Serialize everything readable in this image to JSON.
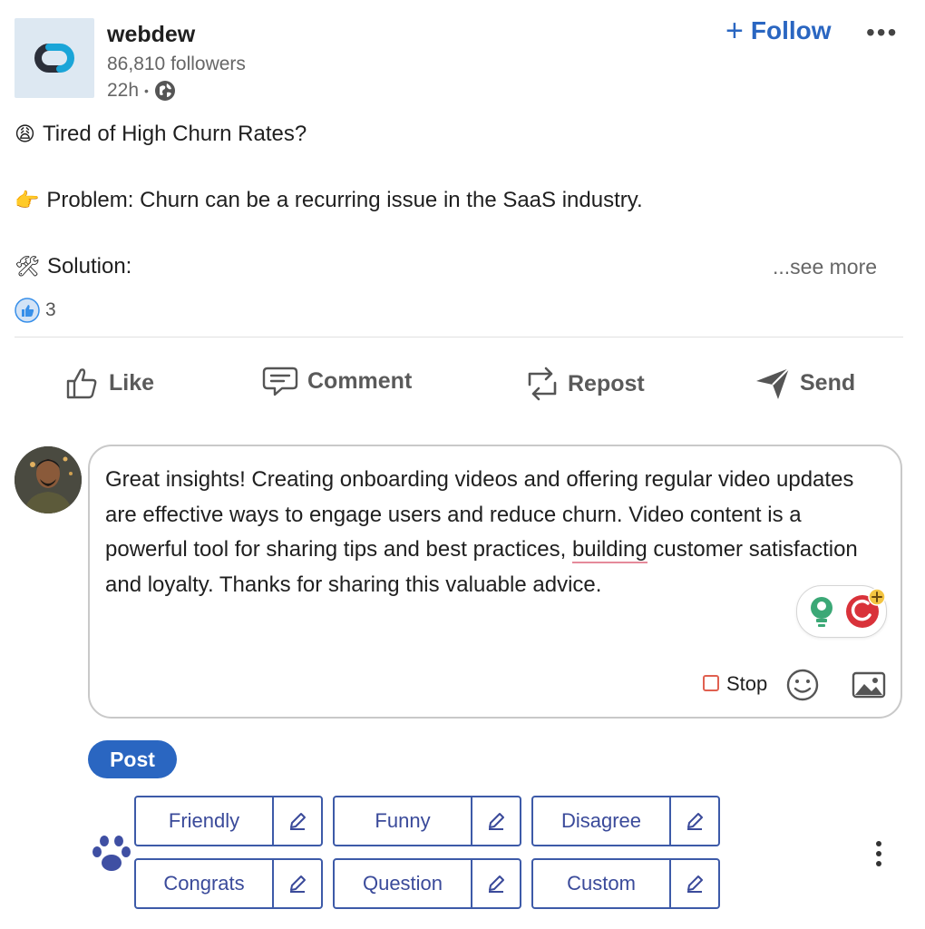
{
  "post": {
    "company_name": "webdew",
    "followers": "86,810 followers",
    "time": "22h",
    "time_sep": "•",
    "follow_label": "Follow",
    "more_label": "•••",
    "lines": [
      {
        "emoji": "😩",
        "text": "Tired of High Churn Rates?"
      },
      {
        "emoji": "👉",
        "text": "Problem: Churn can be a recurring issue in the SaaS industry."
      },
      {
        "emoji": "🛠",
        "text": "Solution:"
      }
    ],
    "see_more": "...see more",
    "reaction_count": "3"
  },
  "actions": {
    "like": "Like",
    "comment": "Comment",
    "repost": "Repost",
    "send": "Send"
  },
  "comment": {
    "text_before": "Great insights! Creating onboarding videos and offering regular video updates are effective ways to engage users and reduce churn. Video content is a powerful tool for sharing tips and best practices, ",
    "text_underlined": "building",
    "text_after": " customer satisfaction and loyalty. Thanks for sharing this valuable advice.",
    "stop_label": "Stop",
    "post_label": "Post"
  },
  "tone_chips": [
    {
      "label": "Friendly"
    },
    {
      "label": "Funny"
    },
    {
      "label": "Disagree"
    },
    {
      "label": "Congrats"
    },
    {
      "label": "Question"
    },
    {
      "label": "Custom"
    }
  ],
  "colors": {
    "accent": "#2a66c1",
    "chip_border": "#3d5aa8",
    "chip_text": "#3a4a9a",
    "stop_red": "#e06050"
  }
}
